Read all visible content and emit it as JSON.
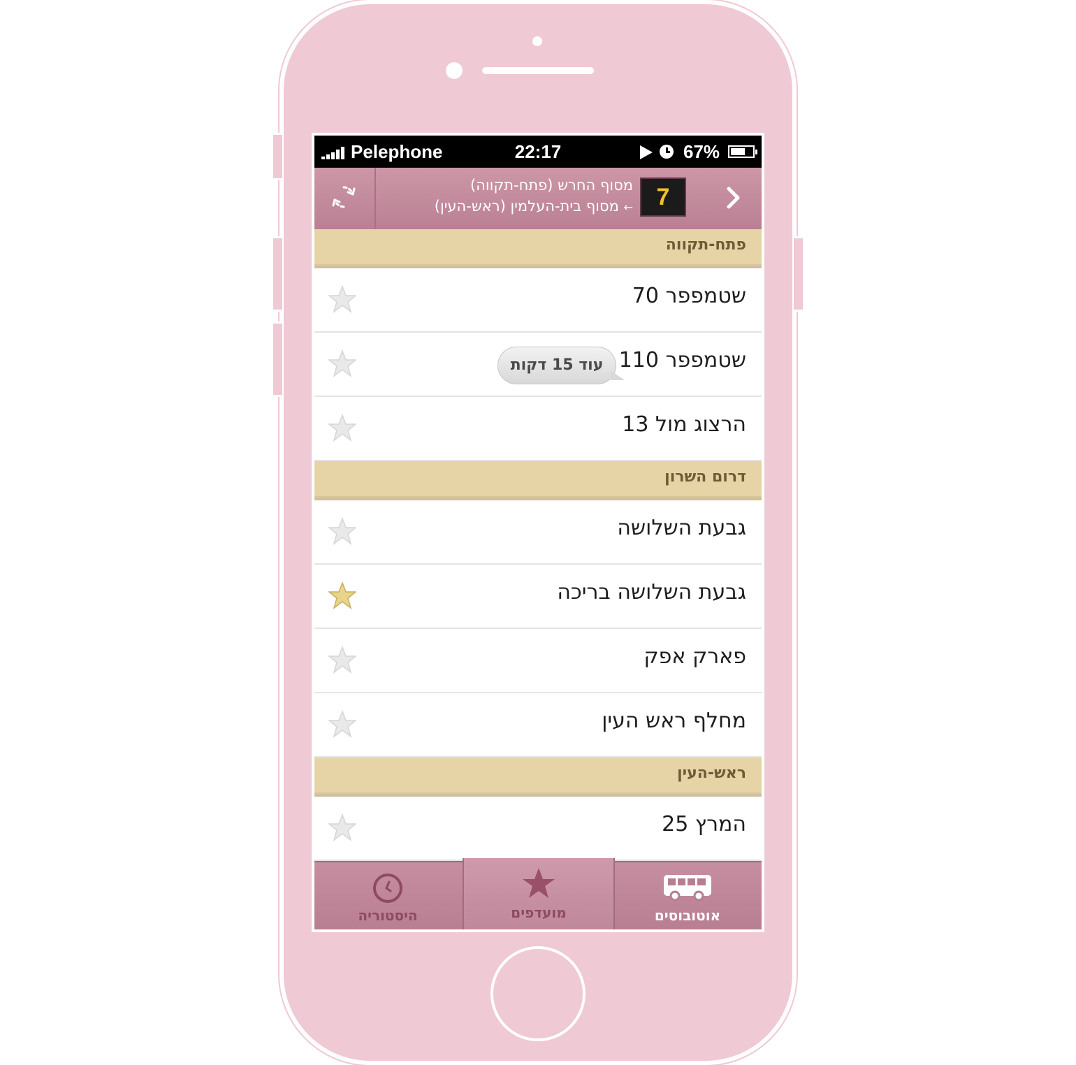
{
  "status_bar": {
    "carrier": "Pelephone",
    "time": "22:17",
    "battery": "67%",
    "battery_level": 0.67
  },
  "nav": {
    "line_number": "7",
    "route_from": "מסוף החרש (פתח-תקווה)",
    "route_to": "מסוף בית-העלמין (ראש-העין)",
    "route_arrow": "←",
    "refresh_icon": "refresh-icon",
    "forward_icon": "chevron-right-icon"
  },
  "sections": [
    {
      "title": "פתח-תקווה",
      "stops": [
        {
          "name": "שטמפפר 70",
          "favorite": false
        },
        {
          "name": "שטמפפר 110",
          "favorite": false,
          "eta": "עוד 15 דקות"
        },
        {
          "name": "הרצוג מול 13",
          "favorite": false
        }
      ]
    },
    {
      "title": "דרום השרון",
      "stops": [
        {
          "name": "גבעת השלושה",
          "favorite": false
        },
        {
          "name": "גבעת השלושה בריכה",
          "favorite": true
        },
        {
          "name": "פארק אפק",
          "favorite": false
        },
        {
          "name": "מחלף ראש העין",
          "favorite": false
        }
      ]
    },
    {
      "title": "ראש-העין",
      "stops": [
        {
          "name": "המרץ 25",
          "favorite": false
        }
      ]
    }
  ],
  "tabs": [
    {
      "label": "היסטוריה",
      "icon": "clock-icon",
      "selected": false
    },
    {
      "label": "מועדפים",
      "icon": "star-icon",
      "selected": true
    },
    {
      "label": "אוטובוסים",
      "icon": "bus-icon",
      "selected": false
    }
  ],
  "colors": {
    "phone_body": "#efc9d4",
    "nav_bar": "#c38a9c",
    "section_header": "#e6d4a6",
    "line_number_text": "#f1c22c",
    "favorite_star": "#e7d58a",
    "inactive_star": "#e9e9e9"
  }
}
